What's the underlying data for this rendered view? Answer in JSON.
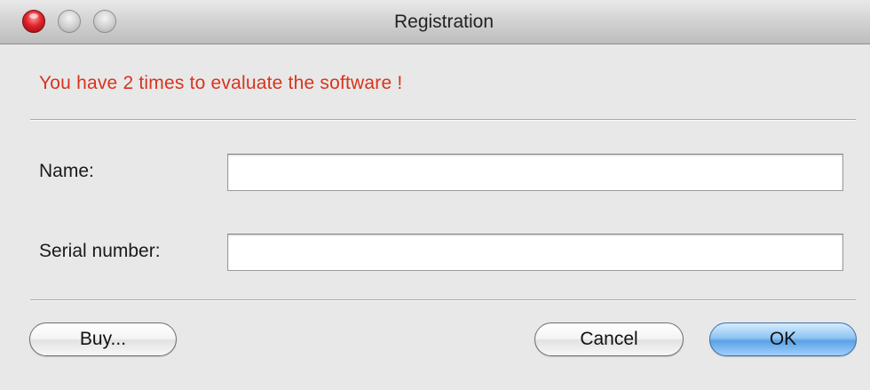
{
  "window": {
    "title": "Registration"
  },
  "message": {
    "text": "You have 2 times to evaluate the software !",
    "color": "#d7341e"
  },
  "form": {
    "name_label": "Name:",
    "name_value": "",
    "serial_label": "Serial number:",
    "serial_value": ""
  },
  "buttons": {
    "buy_label": "Buy...",
    "cancel_label": "Cancel",
    "ok_label": "OK"
  },
  "icons": {
    "close": "close-icon",
    "minimize": "minimize-icon",
    "zoom": "zoom-icon"
  },
  "colors": {
    "default_button": "#5aa2e6",
    "close_button": "#e0242a"
  }
}
